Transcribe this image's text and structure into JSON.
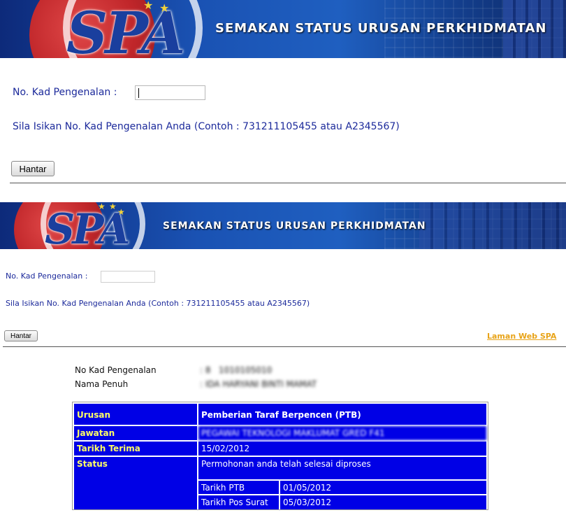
{
  "banner": {
    "title": "SEMAKAN STATUS URUSAN PERKHIDMATAN",
    "logo_text": "SPA"
  },
  "form_top": {
    "ic_label": "No. Kad Pengenalan :",
    "ic_value": "",
    "instruction": "Sila Isikan No. Kad Pengenalan Anda (Contoh : 731211105455 atau A2345567)",
    "submit_label": "Hantar"
  },
  "form_bottom": {
    "ic_label": "No. Kad Pengenalan :",
    "ic_value": "",
    "instruction": "Sila Isikan No. Kad Pengenalan Anda (Contoh : 731211105455 atau A2345567)",
    "submit_label": "Hantar",
    "website_link": "Laman Web SPA"
  },
  "result": {
    "ic_label": "No Kad Pengenalan",
    "ic_value": ": 8   1010105010",
    "name_label": "Nama Penuh",
    "name_value": ": IDA HARYANI BINTI MAMAT",
    "table": {
      "urusan_label": "Urusan",
      "urusan_value": "Pemberian Taraf Berpencen (PTB)",
      "jawatan_label": "Jawatan",
      "jawatan_value": "PEGAWAI TEKNOLOGI MAKLUMAT GRED F41",
      "tarikh_terima_label": "Tarikh Terima",
      "tarikh_terima_value": "15/02/2012",
      "status_label": "Status",
      "status_value": "Permohonan anda telah selesai diproses",
      "tarikh_ptb_label": "Tarikh PTB",
      "tarikh_ptb_value": "01/05/2012",
      "tarikh_pos_label": "Tarikh Pos Surat",
      "tarikh_pos_value": "05/03/2012"
    }
  },
  "colors": {
    "label_blue": "#1c2a9b",
    "table_blue": "#0000e6",
    "table_head_text": "#ffff66",
    "link_orange": "#e8a317"
  }
}
